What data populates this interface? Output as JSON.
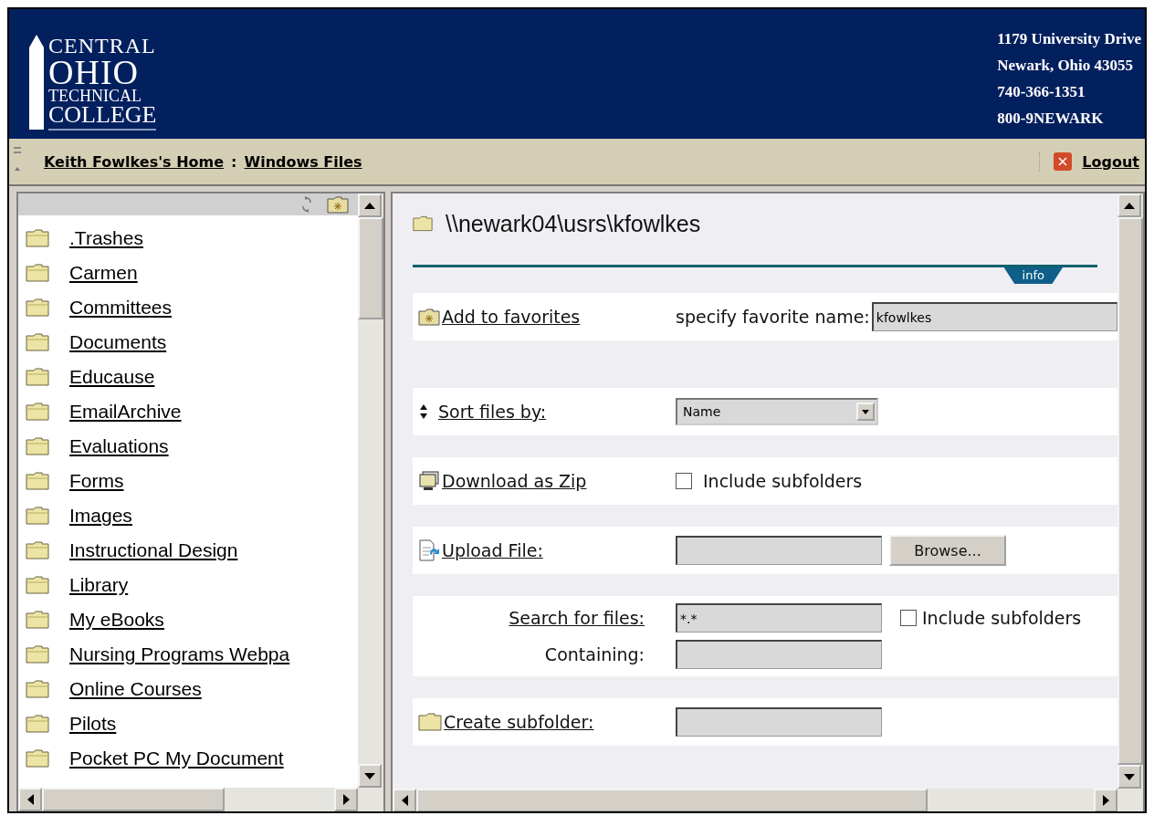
{
  "header": {
    "logo_lines": [
      "CENTRAL",
      "OHIO",
      "TECHNICAL",
      "COLLEGE"
    ],
    "address_lines": [
      "1179 University Drive",
      "Newark, Ohio 43055",
      "740-366-1351",
      "800-9NEWARK"
    ]
  },
  "breadcrumb": {
    "items": [
      "Keith Fowlkes's Home",
      "Windows Files"
    ],
    "separator": ":"
  },
  "logout": "Logout",
  "folders": [
    ".Trashes",
    "Carmen",
    "Committees",
    "Documents",
    "Educause",
    "EmailArchive",
    "Evaluations",
    "Forms",
    "Images",
    "Instructional Design",
    "Library",
    "My eBooks",
    "Nursing Programs Webpa",
    "Online Courses",
    "Pilots",
    "Pocket PC My Document"
  ],
  "path": "\\\\newark04\\usrs\\kfowlkes",
  "info_tab": "info",
  "favorites": {
    "link": "Add to favorites",
    "label": "specify favorite name:",
    "value": "kfowlkes"
  },
  "sort": {
    "link": "Sort files by:",
    "value": "Name"
  },
  "download": {
    "link": "Download as Zip",
    "checkbox": "Include subfolders",
    "checked": false
  },
  "upload": {
    "link": "Upload File:",
    "button": "Browse..."
  },
  "search": {
    "link": "Search for files:",
    "value": "*.*",
    "checkbox": "Include subfolders",
    "checked": false,
    "containing": "Containing:"
  },
  "subfolder": {
    "link": "Create subfolder:"
  }
}
